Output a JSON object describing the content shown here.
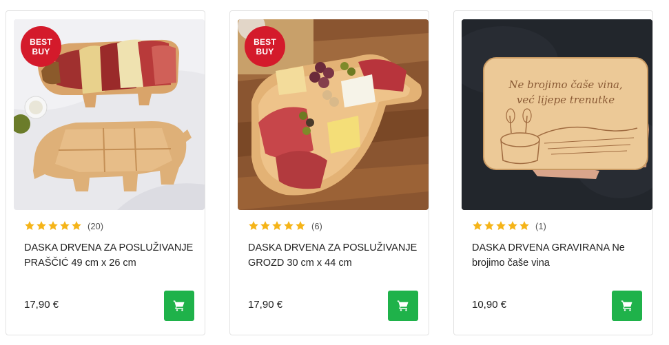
{
  "colors": {
    "badge": "#d41a2b",
    "star": "#f5b418",
    "cart_button": "#1fb24a"
  },
  "products": [
    {
      "badge": {
        "line1": "BEST",
        "line2": "BUY"
      },
      "rating": 5,
      "review_count": "(20)",
      "title": "DASKA DRVENA ZA POSLUŽIVANJE PRAŠČIĆ 49 cm x 26 cm",
      "price": "17,90 €",
      "cart_icon": "cart-icon"
    },
    {
      "badge": {
        "line1": "BEST",
        "line2": "BUY"
      },
      "rating": 5,
      "review_count": "(6)",
      "title": "DASKA DRVENA ZA POSLUŽIVANJE GROZD 30 cm x 44 cm",
      "price": "17,90 €",
      "cart_icon": "cart-icon"
    },
    {
      "rating": 5,
      "review_count": "(1)",
      "title": "DASKA DRVENA GRAVIRANA Ne brojimo čaše vina",
      "price": "10,90 €",
      "cart_icon": "cart-icon",
      "engraving": {
        "line1": "Ne brojimo čaše vina,",
        "line2": "već lijepe trenutke"
      }
    }
  ]
}
